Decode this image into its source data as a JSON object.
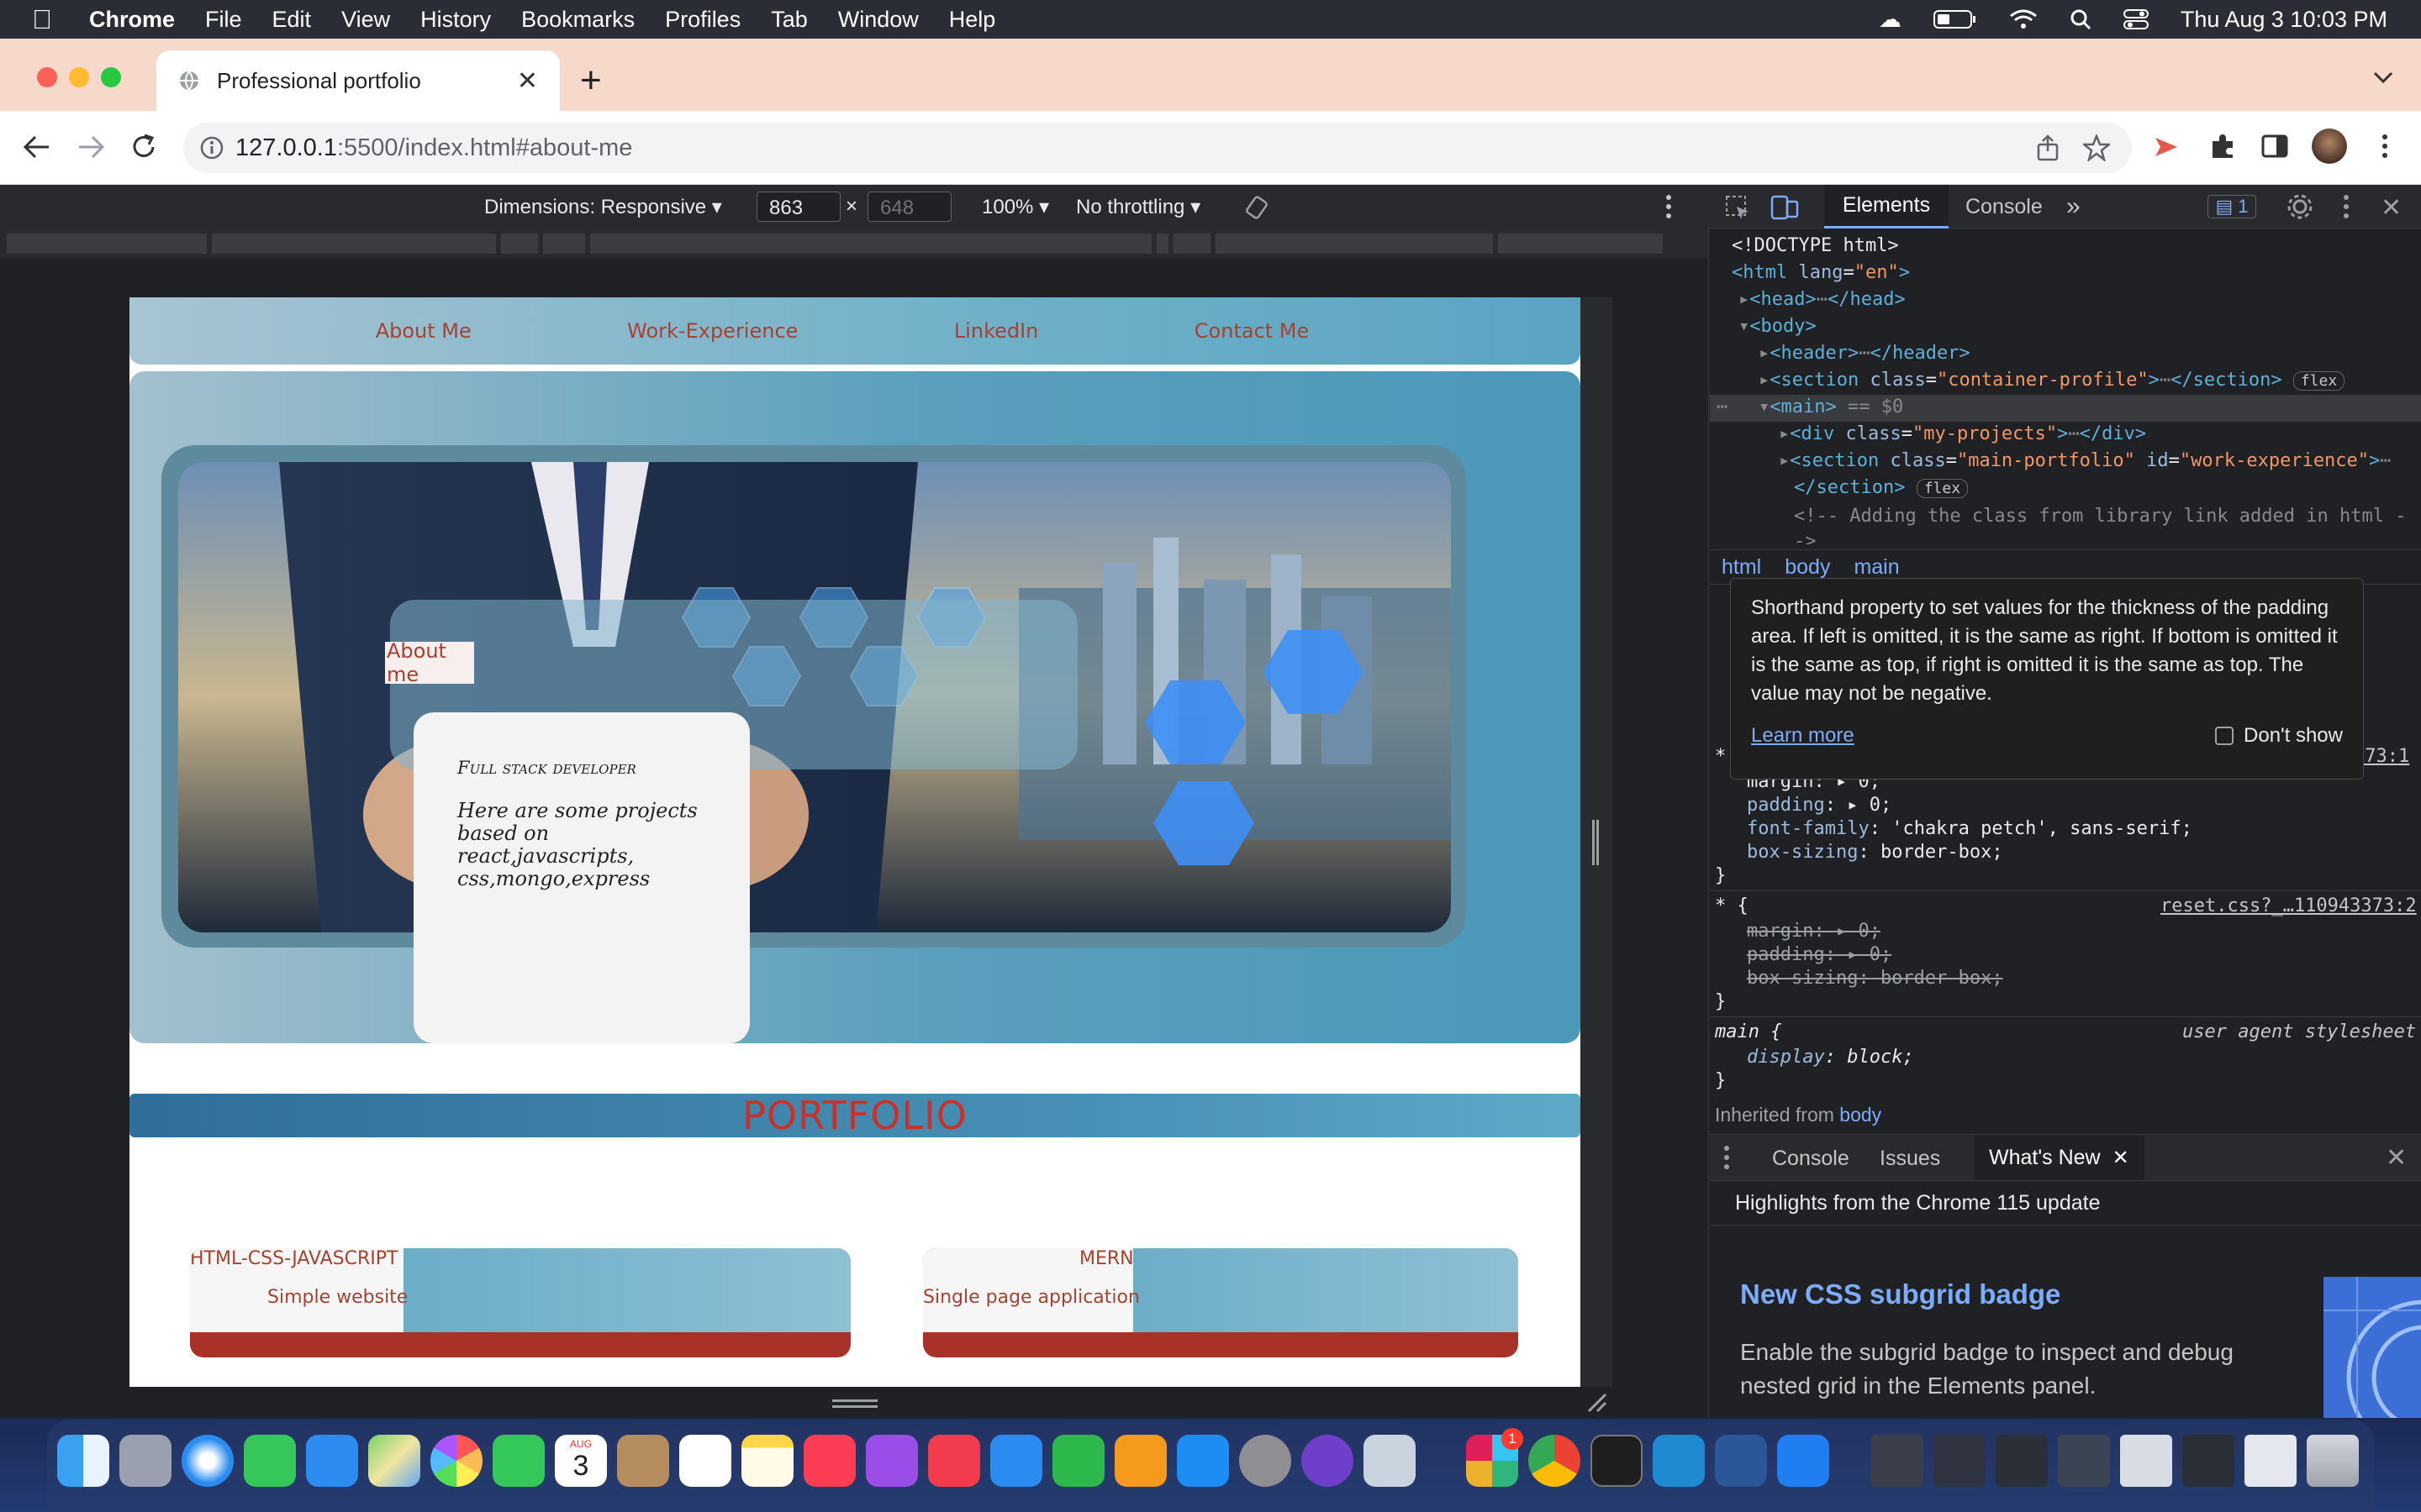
{
  "menubar": {
    "app": "Chrome",
    "items": [
      "File",
      "Edit",
      "View",
      "History",
      "Bookmarks",
      "Profiles",
      "Tab",
      "Window",
      "Help"
    ],
    "clock": "Thu Aug 3  10:03 PM"
  },
  "browser": {
    "tab_title": "Professional portfolio",
    "url_host": "127.0.0.1",
    "url_path": ":5500/index.html#about-me"
  },
  "device_toolbar": {
    "dimensions": "Dimensions: Responsive",
    "width": "863",
    "times": "×",
    "height": "648",
    "zoom": "100%",
    "throttling": "No throttling"
  },
  "page": {
    "nav": [
      "About Me",
      "Work-Experience",
      "LinkedIn",
      "Contact Me"
    ],
    "about_tag": "About me",
    "role": "Full stack developer",
    "description": "Here are some projects based on react,javascripts, css,mongo,express",
    "portfolio_title": "PORTFOLIO",
    "projects": [
      {
        "title": "HTML-CSS-JAVASCRIPT",
        "subtitle": "Simple website"
      },
      {
        "title": "MERN",
        "subtitle": "Single page application"
      }
    ]
  },
  "devtools": {
    "tabs": [
      "Elements",
      "Console"
    ],
    "issues_count": "1",
    "dom": {
      "doctype": "<!DOCTYPE html>",
      "html_open": "<html",
      "html_attr": "lang",
      "html_val": "\"en\"",
      "head": "<head>",
      "head_close": "</head>",
      "body": "<body>",
      "header": "<header>",
      "header_close": "</header>",
      "section_open": "<section",
      "section_attr": "class",
      "section_val": "\"container-profile\"",
      "section_close": "</section>",
      "flex_badge": "flex",
      "main": "<main>",
      "main_eq": "== $0",
      "div_open": "<div",
      "div_attr": "class",
      "div_val": "\"my-projects\"",
      "div_close": "</div>",
      "section2_attr1": "class",
      "section2_val1": "\"main-portfolio\"",
      "section2_attr2": "id",
      "section2_val2": "\"work-experience\"",
      "section2_close": "</section>",
      "comment": "<!-- Adding the class from library link added in html -->"
    },
    "breadcrumbs": [
      "html",
      "body",
      "main"
    ],
    "tooltip": {
      "text": "Shorthand property to set values for the thickness of the padding area. If left is omitted, it is the same as right. If bottom is omitted it is the same as top, if right is omitted it is the same as top. The value may not be negative.",
      "learn_more": "Learn more",
      "dont_show": "Don't show"
    },
    "styles": {
      "rule1_src": "373:1",
      "rule1_margin": "margin: ▸ 0;",
      "rule1_padding_prop": "padding",
      "rule1_padding_val": "▸ 0;",
      "rule1_font_prop": "font-family",
      "rule1_font_val": "'chakra petch', sans-serif;",
      "rule1_box_prop": "box-sizing",
      "rule1_box_val": "border-box;",
      "rule2_selector": "* {",
      "rule2_src": "reset.css?_…110943373:2",
      "rule2_margin": "margin: ▸ 0;",
      "rule2_padding": "padding: ▸ 0;",
      "rule2_box": "box-sizing: border-box;",
      "rule3_selector": "main {",
      "rule3_src": "user agent stylesheet",
      "rule3_prop": "display",
      "rule3_val": "block;",
      "inherited_label": "Inherited from",
      "inherited_from": "body",
      "close_brace": "}"
    },
    "drawer": {
      "tabs": [
        "Console",
        "Issues",
        "What's New"
      ],
      "highlights": "Highlights from the Chrome 115 update",
      "feature_title": "New CSS subgrid badge",
      "feature_desc": "Enable the subgrid badge to inspect and debug nested grid in the Elements panel."
    }
  },
  "dock": {
    "calendar_month": "AUG",
    "calendar_day": "3",
    "slack_badge": "1"
  }
}
